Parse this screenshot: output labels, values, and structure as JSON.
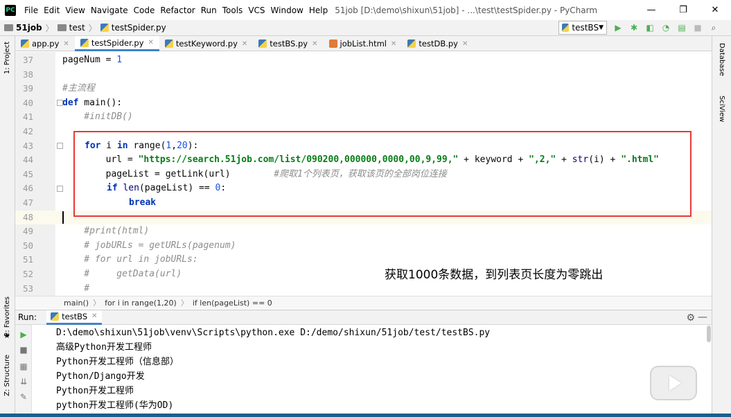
{
  "app": {
    "icon_label": "PC",
    "window_title": "51job [D:\\demo\\shixun\\51job] - ...\\test\\testSpider.py - PyCharm",
    "menu": [
      "File",
      "Edit",
      "View",
      "Navigate",
      "Code",
      "Refactor",
      "Run",
      "Tools",
      "VCS",
      "Window",
      "Help"
    ],
    "window_controls": {
      "minimize": "—",
      "restore": "❐",
      "close": "✕"
    }
  },
  "navbar": {
    "project": "51job",
    "folder": "test",
    "file": "testSpider.py",
    "run_config": "testBS"
  },
  "left_stripe": {
    "project": "1: Project",
    "favorites": "2: Favorites",
    "structure": "Z: Structure"
  },
  "right_stripe": {
    "database": "Database",
    "sciview": "SciView"
  },
  "tabs": [
    {
      "label": "app.py",
      "active": false
    },
    {
      "label": "testSpider.py",
      "active": true
    },
    {
      "label": "testKeyword.py",
      "active": false
    },
    {
      "label": "testBS.py",
      "active": false
    },
    {
      "label": "jobList.html",
      "active": false
    },
    {
      "label": "testDB.py",
      "active": false
    }
  ],
  "editor": {
    "line_numbers": [
      "37",
      "38",
      "39",
      "40",
      "41",
      "42",
      "43",
      "44",
      "45",
      "46",
      "47",
      "48",
      "49",
      "50",
      "51",
      "52",
      "53"
    ],
    "code": {
      "l37_a": "pageNum",
      "l37_b": " = ",
      "l37_c": "1",
      "l39": "#主流程",
      "l40_kw": "def",
      "l40_rest": " main():",
      "l41": "    #initDB()",
      "l43_kw1": "for",
      "l43_mid": " i ",
      "l43_kw2": "in",
      "l43_range": " range(",
      "l43_n1": "1",
      "l43_comma": ",",
      "l43_n2": "20",
      "l43_end": "):",
      "l44_a": "        url = ",
      "l44_str1": "\"https://search.51job.com/list/090200,000000,0000,00,9,99,\"",
      "l44_b": " + keyword + ",
      "l44_str2": "\",2,\"",
      "l44_c": " + ",
      "l44_str_fn": "str",
      "l44_d": "(i) + ",
      "l44_str3": "\".html\"",
      "l45_a": "        pageList = getLink(url)",
      "l45_cmt": "        #爬取1个列表页，获取该页的全部岗位连接",
      "l46_kw": "if",
      "l46_len": " len",
      "l46_mid": "(pageList) == ",
      "l46_n": "0",
      "l46_end": ":",
      "l47_kw": "break",
      "l49": "    #print(html)",
      "l50": "    # jobURLs = getURLs(pagenum)",
      "l51": "    # for url in jobURLs:",
      "l52": "    #     getData(url)",
      "l53": "    #"
    },
    "annotation": "获取1000条数据，到列表页长度为零跳出"
  },
  "breadcrumb": [
    "main()",
    "for i in range(1,20)",
    "if len(pageList) == 0"
  ],
  "run_panel": {
    "label": "Run:",
    "tab": "testBS",
    "console": [
      "D:\\demo\\shixun\\51job\\venv\\Scripts\\python.exe D:/demo/shixun/51job/test/testBS.py",
      "高级Python开发工程师",
      "Python开发工程师（信息部）",
      "Python/Django开发",
      "Python开发工程师",
      "python开发工程师(华为OD)"
    ]
  },
  "colors": {
    "accent": "#4083c9",
    "highlight_box": "#e53935",
    "keyword": "#0033b3",
    "string": "#067d17"
  }
}
